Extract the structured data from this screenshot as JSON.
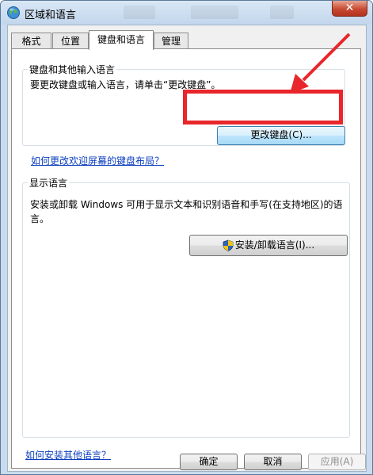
{
  "window": {
    "title": "区域和语言",
    "close_label": "✕"
  },
  "tabs": [
    {
      "label": "格式"
    },
    {
      "label": "位置"
    },
    {
      "label": "键盘和语言"
    },
    {
      "label": "管理"
    }
  ],
  "keyboard_group": {
    "title": "键盘和其他输入语言",
    "description": "要更改键盘或输入语言，请单击“更改键盘”。",
    "change_keyboard_button": "更改键盘(C)...",
    "welcome_link": "如何更改欢迎屏幕的键盘布局？"
  },
  "display_group": {
    "title": "显示语言",
    "description_line1": "安装或卸载 Windows 可用于显示文本和识别语音和手写(在支持地区)的语",
    "description_line2": "言。",
    "install_button": "安装/卸载语言(I)..."
  },
  "footer": {
    "other_language_link": "如何安装其他语言？",
    "ok_button": "确定",
    "cancel_button": "取消",
    "apply_button": "应用(A)"
  },
  "colors": {
    "annotation": "#e8262b",
    "link": "#0b3fbf"
  },
  "icons": {
    "title": "globe-icon",
    "install": "shield-icon"
  }
}
